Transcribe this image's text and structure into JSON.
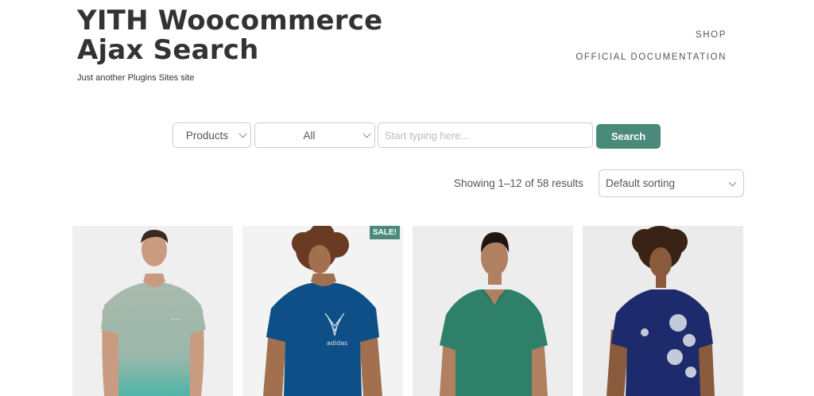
{
  "header": {
    "title": "YITH Woocommerce Ajax Search",
    "tagline": "Just another Plugins Sites site"
  },
  "nav": {
    "items": [
      "SHOP",
      "OFFICIAL DOCUMENTATION"
    ]
  },
  "search": {
    "post_type_value": "Products",
    "category_value": "All",
    "placeholder": "Start typing here...",
    "button_label": "Search"
  },
  "shop": {
    "result_count": "Showing 1–12 of 58 results",
    "sorting_value": "Default sorting",
    "sale_badge": "SALE!"
  },
  "colors": {
    "accent": "#4a8a7b"
  },
  "icons": [
    "chevron-down-icon"
  ]
}
